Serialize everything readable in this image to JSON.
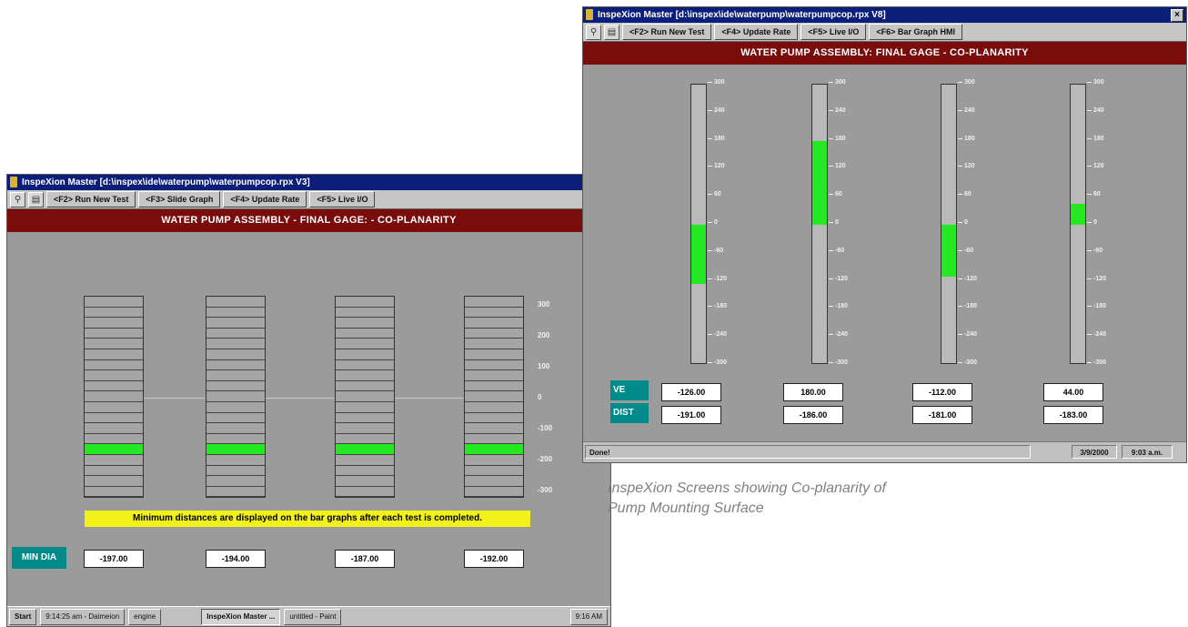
{
  "left_window": {
    "title": "InspeXion Master [d:\\inspex\\ide\\waterpump\\waterpumpcop.rpx V3]",
    "toolbar": {
      "buttons": [
        "<F2> Run New Test",
        "<F3> Slide Graph",
        "<F4> Update Rate",
        "<F5> Live I/O"
      ]
    },
    "banner": "WATER PUMP ASSEMBLY   -   FINAL GAGE:   -   CO-PLANARITY",
    "scale_ticks": [
      "300",
      "200",
      "100",
      "0",
      "-100",
      "-200",
      "-300"
    ],
    "note": "Minimum distances are displayed on the bar graphs after each test is completed.",
    "min_dia_label": "MIN DIA",
    "min_dia_values": [
      "-197.00",
      "-194.00",
      "-187.00",
      "-192.00"
    ],
    "taskbar": {
      "start": "Start",
      "items": [
        "9:14:25 am - Daimeion",
        "engine",
        "InspeXion Master ...",
        "untitled - Paint"
      ],
      "clock": "9:16 AM"
    }
  },
  "right_window": {
    "title": "InspeXion Master [d:\\inspex\\ide\\waterpump\\waterpumpcop.rpx V8]",
    "toolbar": {
      "buttons": [
        "<F2> Run New Test",
        "<F4> Update Rate",
        "<F5> Live I/O",
        "<F6> Bar Graph HMI"
      ]
    },
    "banner": "WATER PUMP ASSEMBLY:   FINAL GAGE   -   CO-PLANARITY",
    "scale_ticks": [
      "300",
      "240",
      "180",
      "120",
      "60",
      "0",
      "-60",
      "-120",
      "-180",
      "-240",
      "-300"
    ],
    "bars": [
      {
        "value": -126
      },
      {
        "value": 180
      },
      {
        "value": -112
      },
      {
        "value": 44
      }
    ],
    "row_labels": [
      "VE",
      "DIST"
    ],
    "ve_values": [
      "-126.00",
      "180.00",
      "-112.00",
      "44.00"
    ],
    "dist_values": [
      "-191.00",
      "-186.00",
      "-181.00",
      "-183.00"
    ],
    "status": {
      "text": "Done!",
      "date": "3/9/2000",
      "time": "9:03 a.m."
    }
  },
  "caption": "InspeXion Screens showing Co-planarity of Pump Mounting Surface",
  "colors": {
    "banner": "#7a0c0c",
    "bar_fill": "#23e823",
    "label_box": "#008a8a",
    "title_bar": "#0a1e7a",
    "note": "#f2f21a"
  }
}
